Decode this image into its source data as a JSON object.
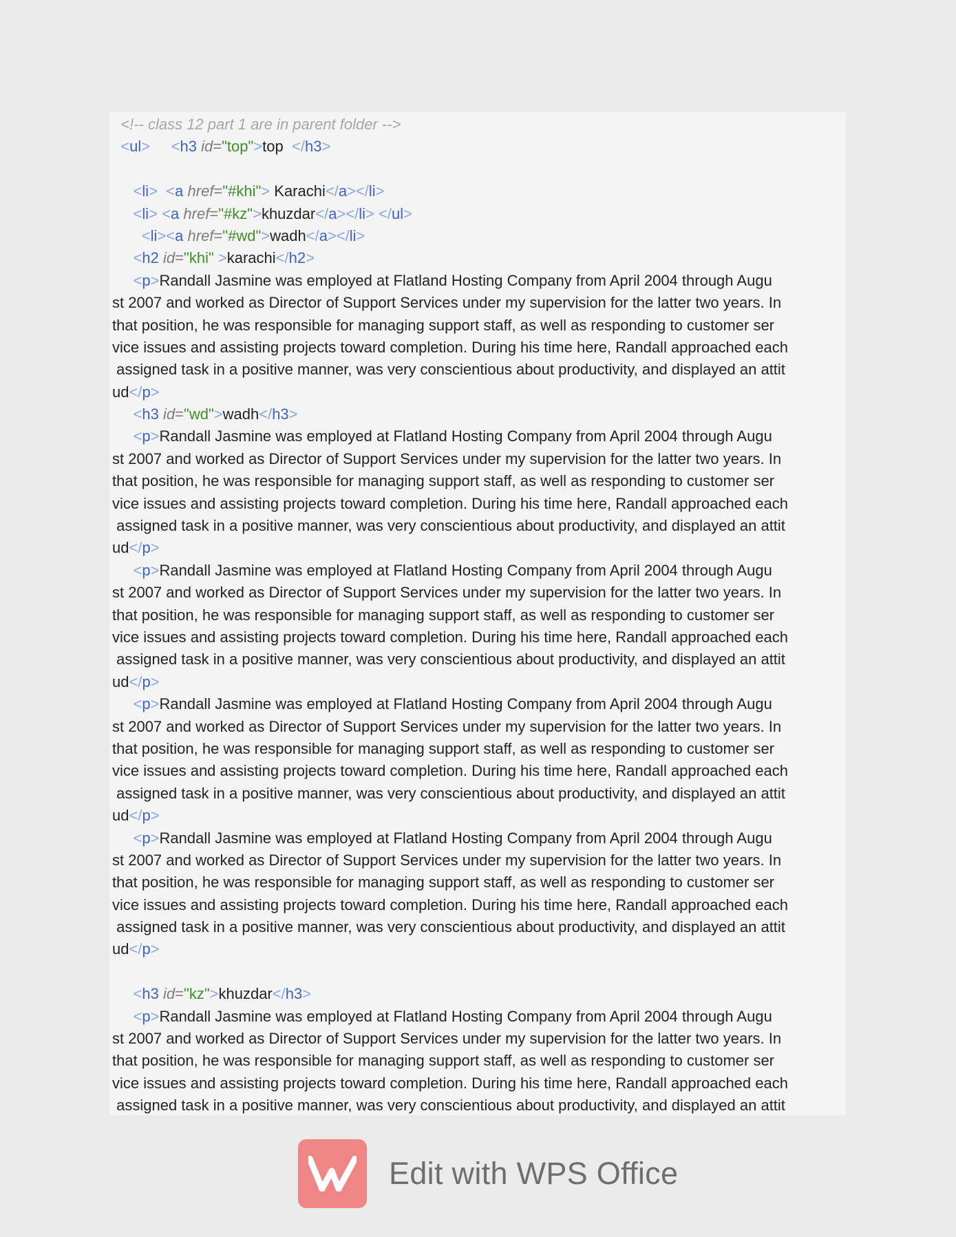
{
  "document": {
    "comment": "<!-- class 12 part 1 are in parent folder -->",
    "nav": {
      "ul_open": "ul",
      "heading_tag": "h3",
      "heading_attr": "id",
      "heading_id": "top",
      "heading_text": "top ",
      "items": [
        {
          "href": "#khi",
          "label": " Karachi"
        },
        {
          "href": "#kz",
          "label": "khuzdar"
        },
        {
          "href": "#wd",
          "label": "wadh"
        }
      ],
      "ul_close": "ul"
    },
    "sections": [
      {
        "tag": "h2",
        "id": "khi",
        "heading": "karachi"
      },
      {
        "tag": "h3",
        "id": "wd",
        "heading": "wadh"
      },
      {
        "tag": "h3",
        "id": "kz",
        "heading": "khuzdar"
      }
    ],
    "paragraph_lines": [
      "Randall Jasmine was employed at Flatland Hosting Company from April 2004 through Augu",
      "st 2007 and worked as Director of Support Services under my supervision for the latter two years. In",
      "that position, he was responsible for managing support staff, as well as responding to customer ser",
      "vice issues and assisting projects toward completion. During his time here, Randall approached each",
      " assigned task in a positive manner, was very conscientious about productivity, and displayed an attit",
      "ud"
    ],
    "p_tag": "p"
  },
  "watermark": {
    "logo_icon": "wps-logo-icon",
    "text": "Edit with WPS Office",
    "logo_color": "#f08585"
  }
}
